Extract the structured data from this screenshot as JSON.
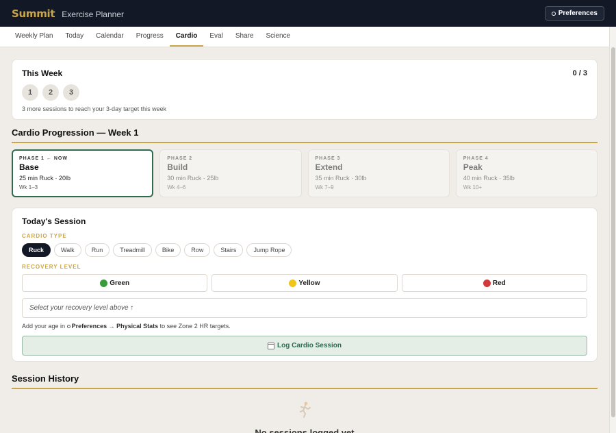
{
  "app": {
    "logo": "Summit",
    "subtitle": "Exercise Planner",
    "preferences_label": "Preferences"
  },
  "nav": {
    "items": [
      {
        "label": "Weekly Plan",
        "active": false
      },
      {
        "label": "Today",
        "active": false
      },
      {
        "label": "Calendar",
        "active": false
      },
      {
        "label": "Progress",
        "active": false
      },
      {
        "label": "Cardio",
        "active": true
      },
      {
        "label": "Eval",
        "active": false
      },
      {
        "label": "Share",
        "active": false
      },
      {
        "label": "Science",
        "active": false
      }
    ]
  },
  "week": {
    "title": "This Week",
    "count": "0 / 3",
    "days": [
      "1",
      "2",
      "3"
    ],
    "note": "3 more sessions to reach your 3-day target this week"
  },
  "progression": {
    "title": "Cardio Progression — Week 1",
    "phases": [
      {
        "label": "PHASE 1 ← NOW",
        "name": "Base",
        "detail": "25 min Ruck · 20lb",
        "weeks": "Wk 1–3",
        "current": true
      },
      {
        "label": "PHASE 2",
        "name": "Build",
        "detail": "30 min Ruck · 25lb",
        "weeks": "Wk 4–6",
        "current": false
      },
      {
        "label": "PHASE 3",
        "name": "Extend",
        "detail": "35 min Ruck · 30lb",
        "weeks": "Wk 7–9",
        "current": false
      },
      {
        "label": "PHASE 4",
        "name": "Peak",
        "detail": "40 min Ruck · 35lb",
        "weeks": "Wk 10+",
        "current": false
      }
    ]
  },
  "session": {
    "title": "Today's Session",
    "cardio_type_label": "CARDIO TYPE",
    "types": [
      "Ruck",
      "Walk",
      "Run",
      "Treadmill",
      "Bike",
      "Row",
      "Stairs",
      "Jump Rope"
    ],
    "selected_type": "Ruck",
    "recovery_label": "RECOVERY LEVEL",
    "recovery_options": [
      {
        "label": "Green",
        "color": "#3a9b3a"
      },
      {
        "label": "Yellow",
        "color": "#f0c419"
      },
      {
        "label": "Red",
        "color": "#d23a3a"
      }
    ],
    "recovery_hint": "Select your recovery level above ↑",
    "age_note_prefix": "Add your age in",
    "age_note_link": "Preferences → Physical Stats",
    "age_note_suffix": "to see Zone 2 HR targets.",
    "log_button": "Log Cardio Session"
  },
  "history": {
    "title": "Session History",
    "empty_text": "No sessions logged yet"
  },
  "colors": {
    "accent": "#c9a64a",
    "topbar": "#121826",
    "current_phase_border": "#2f6b4f"
  }
}
